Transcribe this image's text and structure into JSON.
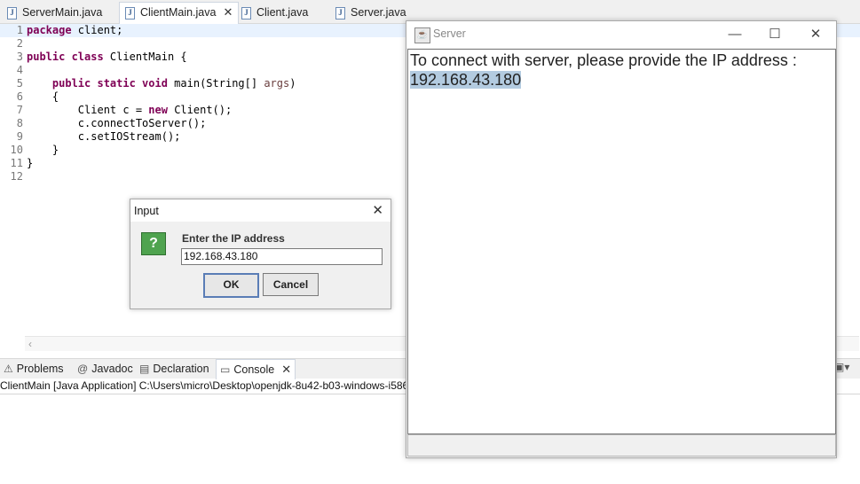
{
  "editor_tabs": [
    {
      "label": "ServerMain.java",
      "active": false
    },
    {
      "label": "ClientMain.java",
      "active": true
    },
    {
      "label": "Client.java",
      "active": false
    },
    {
      "label": "Server.java",
      "active": false
    }
  ],
  "code_lines": [
    {
      "n": "1",
      "text": "package client;"
    },
    {
      "n": "2",
      "text": ""
    },
    {
      "n": "3",
      "text": "public class ClientMain {"
    },
    {
      "n": "4",
      "text": ""
    },
    {
      "n": "5",
      "text": "    public static void main(String[] args)"
    },
    {
      "n": "6",
      "text": "    {"
    },
    {
      "n": "7",
      "text": "        Client c = new Client();"
    },
    {
      "n": "8",
      "text": "        c.connectToServer();"
    },
    {
      "n": "9",
      "text": "        c.setIOStream();"
    },
    {
      "n": "10",
      "text": "    }"
    },
    {
      "n": "11",
      "text": "}"
    },
    {
      "n": "12",
      "text": ""
    }
  ],
  "view_tabs": {
    "problems": "Problems",
    "javadoc": "Javadoc",
    "declaration": "Declaration",
    "console": "Console"
  },
  "console": {
    "header": "ClientMain [Java Application] C:\\Users\\micro\\Desktop\\openjdk-8u42-b03-windows-i586"
  },
  "server_window": {
    "title": "Server",
    "message": "To connect with server, please provide the IP address :",
    "ip": "192.168.43.180"
  },
  "input_dialog": {
    "title": "Input",
    "message": "Enter the IP address",
    "value": "192.168.43.180",
    "ok_label": "OK",
    "cancel_label": "Cancel"
  },
  "icons": {
    "java_file": "java-file-icon",
    "question": "question-icon"
  }
}
